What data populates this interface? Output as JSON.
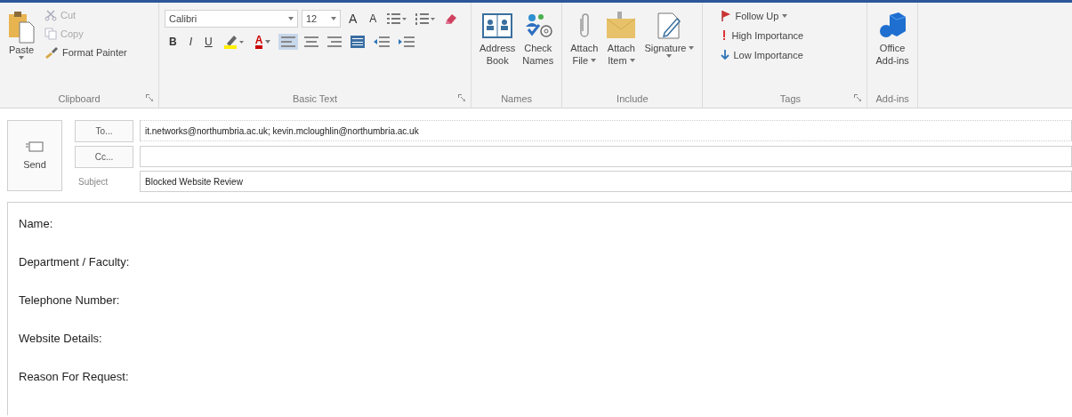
{
  "ribbon": {
    "groups": [
      {
        "kind": "clipboard",
        "label": "Clipboard",
        "launcher": true,
        "paste": "Paste",
        "items": [
          {
            "label": "Cut",
            "disabled": true
          },
          {
            "label": "Copy",
            "disabled": true
          },
          {
            "label": "Format Painter",
            "disabled": false
          }
        ]
      },
      {
        "kind": "basic_text",
        "label": "Basic Text",
        "launcher": true,
        "font": "Calibri",
        "size": "12",
        "grow": "A",
        "shrink": "A",
        "styles": [
          "B",
          "I",
          "U"
        ],
        "font_color": "A"
      },
      {
        "kind": "large",
        "label": "Names",
        "launcher": false,
        "items": [
          {
            "lines": [
              "Address",
              "Book"
            ],
            "dropdown": false
          },
          {
            "lines": [
              "Check",
              "Names"
            ],
            "dropdown": false
          }
        ]
      },
      {
        "kind": "large",
        "label": "Include",
        "launcher": false,
        "items": [
          {
            "lines": [
              "Attach",
              "File"
            ],
            "dropdown": true
          },
          {
            "lines": [
              "Attach",
              "Item"
            ],
            "dropdown": true
          },
          {
            "lines": [
              "Signature"
            ],
            "dropdown": true
          }
        ]
      },
      {
        "kind": "list",
        "label": "Tags",
        "launcher": true,
        "items": [
          {
            "label": "Follow Up",
            "dropdown": true
          },
          {
            "label": "High Importance",
            "dropdown": false
          },
          {
            "label": "Low Importance",
            "dropdown": false
          }
        ]
      },
      {
        "kind": "large",
        "label": "Add-ins",
        "launcher": false,
        "items": [
          {
            "lines": [
              "Office",
              "Add-ins"
            ],
            "dropdown": false
          }
        ]
      }
    ]
  },
  "message": {
    "send": "Send",
    "to_button": "To...",
    "to": "it.networks@northumbria.ac.uk; kevin.mcloughlin@northumbria.ac.uk",
    "cc_button": "Cc...",
    "subject_label": "Subject",
    "subject": "Blocked Website Review"
  },
  "body": {
    "lines": [
      "Name:",
      "Department / Faculty:",
      "Telephone Number:",
      "Website Details:",
      "Reason For Request:"
    ]
  }
}
